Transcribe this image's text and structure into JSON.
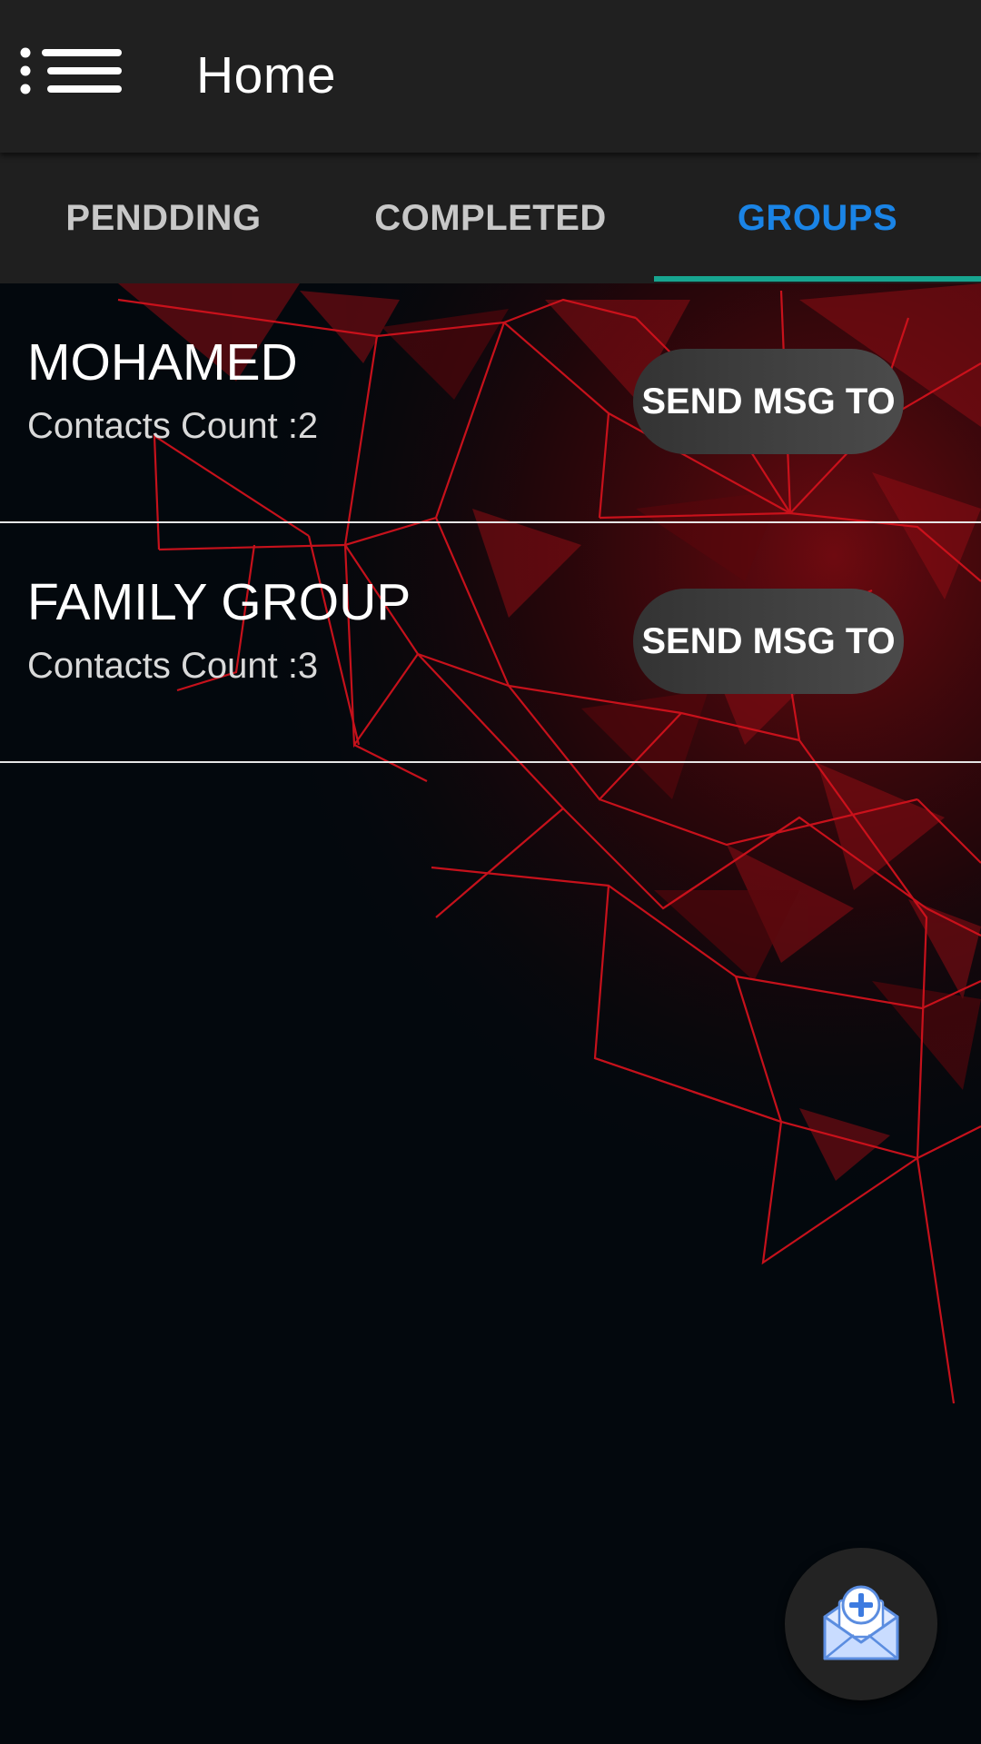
{
  "appbar": {
    "title": "Home",
    "menu_icon": "menu-list-icon"
  },
  "tabs": [
    {
      "label": "PENDDING",
      "active": false
    },
    {
      "label": "COMPLETED",
      "active": false
    },
    {
      "label": "GROUPS",
      "active": true
    }
  ],
  "groups": [
    {
      "name": "MOHAMED",
      "count_text": "Contacts Count :2",
      "button_label": "SEND MSG TO"
    },
    {
      "name": "FAMILY GROUP",
      "count_text": "Contacts Count :3",
      "button_label": "SEND MSG TO"
    }
  ],
  "fab": {
    "icon": "envelope-plus-icon"
  },
  "colors": {
    "appbar_bg": "#202020",
    "tab_active": "#1a84e6",
    "tab_inactive": "#c8c8c8",
    "tab_indicator": "#17a590",
    "background": "#03080d",
    "accent_red": "#d0121c"
  }
}
